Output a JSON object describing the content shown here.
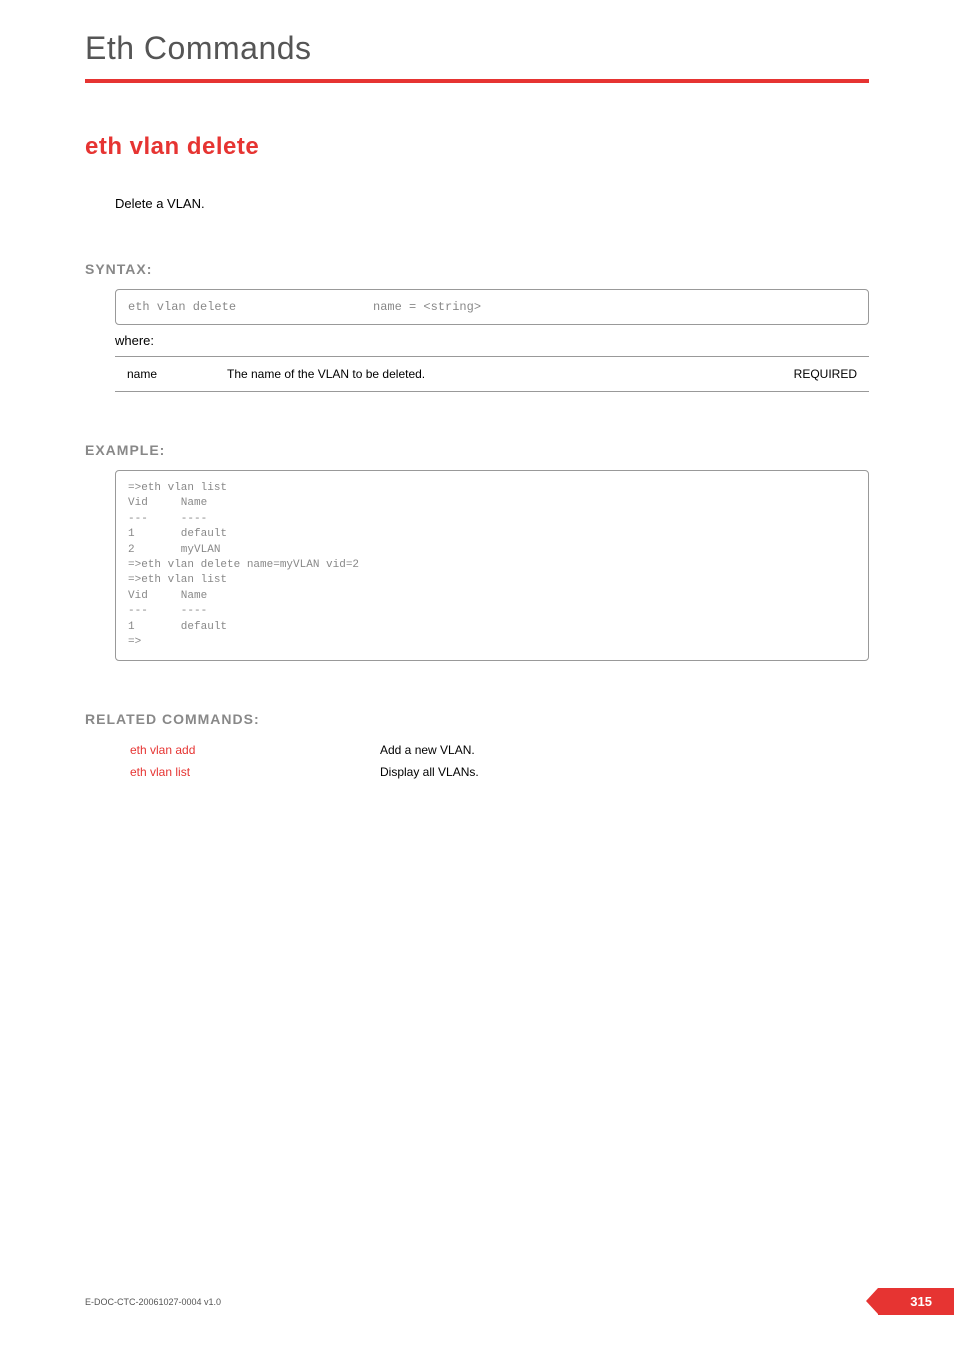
{
  "header": {
    "title": "Eth Commands"
  },
  "command": {
    "title": "eth vlan delete",
    "description": "Delete a VLAN."
  },
  "syntax": {
    "heading": "SYNTAX:",
    "command": "eth vlan delete",
    "args": "name = <string>",
    "where": "where:",
    "params": [
      {
        "name": "name",
        "description": "The name of the VLAN to be deleted.",
        "required": "REQUIRED"
      }
    ]
  },
  "example": {
    "heading": "EXAMPLE:",
    "content": "=>eth vlan list\nVid     Name\n---     ----\n1       default\n2       myVLAN\n=>eth vlan delete name=myVLAN vid=2\n=>eth vlan list\nVid     Name\n---     ----\n1       default\n=>"
  },
  "related": {
    "heading": "RELATED COMMANDS:",
    "items": [
      {
        "cmd": "eth vlan add",
        "desc": "Add a new VLAN."
      },
      {
        "cmd": "eth vlan list",
        "desc": "Display all VLANs."
      }
    ]
  },
  "footer": {
    "doc": "E-DOC-CTC-20061027-0004 v1.0",
    "page": "315"
  }
}
